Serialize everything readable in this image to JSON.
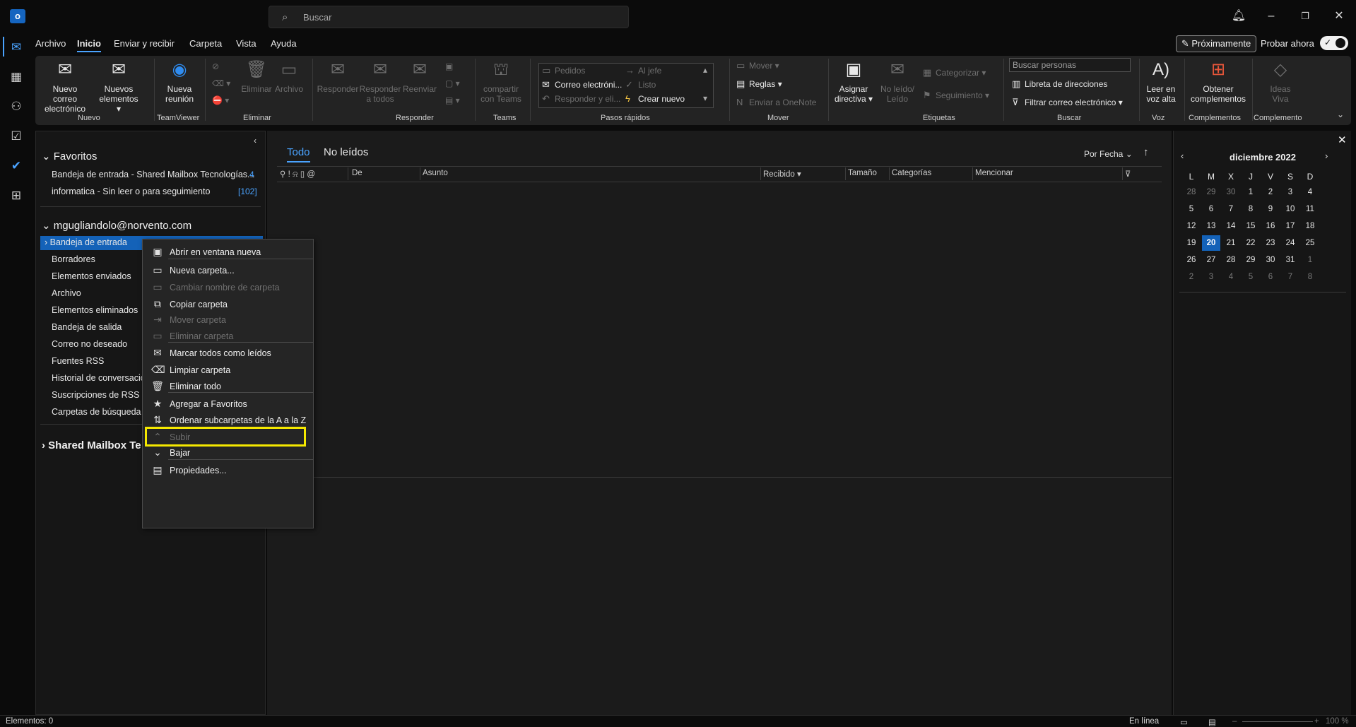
{
  "app": {
    "logo": "o"
  },
  "search": {
    "placeholder": "Buscar"
  },
  "menu": {
    "tabs": [
      "Archivo",
      "Inicio",
      "Enviar y recibir",
      "Carpeta",
      "Vista",
      "Ayuda"
    ],
    "active": "Inicio",
    "proximamente": "Próximamente",
    "probar_ahora": "Probar ahora"
  },
  "ribbon": {
    "nuevo_correo": [
      "Nuevo correo",
      "electrónico"
    ],
    "nuevos_elementos": [
      "Nuevos",
      "elementos"
    ],
    "nueva_reunion": [
      "Nueva",
      "reunión"
    ],
    "eliminar": "Eliminar",
    "archivo": "Archivo",
    "responder": "Responder",
    "responder_todos": [
      "Responder",
      "a todos"
    ],
    "reenviar": "Reenviar",
    "compartir_teams": [
      "compartir",
      "con Teams"
    ],
    "qs_pedidos": "Pedidos",
    "qs_jefe": "Al jefe",
    "qs_correo": "Correo electróni...",
    "qs_listo": "Listo",
    "qs_responder": "Responder y eli...",
    "qs_crear": "Crear nuevo",
    "mover": "Mover",
    "reglas": "Reglas",
    "onenote": "Enviar a OneNote",
    "asignar": [
      "Asignar",
      "directiva"
    ],
    "noleido": [
      "No leído/",
      "Leído"
    ],
    "categorizar": "Categorizar",
    "seguimiento": "Seguimiento",
    "buscar_personas": "Buscar personas",
    "libreta": "Libreta de direcciones",
    "filtrar": "Filtrar correo electrónico",
    "leer_voz": [
      "Leer en",
      "voz alta"
    ],
    "obtener": [
      "Obtener",
      "complementos"
    ],
    "ideas": [
      "Ideas",
      "Viva"
    ],
    "groups": [
      "Nuevo",
      "TeamViewer",
      "Eliminar",
      "Responder",
      "Teams",
      "Pasos rápidos",
      "Mover",
      "Etiquetas",
      "Buscar",
      "Voz",
      "Complementos",
      "Complemento"
    ]
  },
  "folders": {
    "favoritos": "Favoritos",
    "fav_items": [
      {
        "label": "Bandeja de entrada - Shared Mailbox Tecnologías...",
        "count": "4"
      },
      {
        "label": "informatica - Sin leer o para seguimiento",
        "count": "[102]"
      }
    ],
    "account": "mgugliandolo@norvento.com",
    "items": [
      "Bandeja de entrada",
      "Borradores",
      "Elementos enviados",
      "Archivo",
      "Elementos eliminados",
      "Bandeja de salida",
      "Correo no deseado",
      "Fuentes RSS",
      "Historial de conversacion",
      "Suscripciones de RSS",
      "Carpetas de búsqueda"
    ],
    "shared": "Shared Mailbox Te"
  },
  "list": {
    "tab_todo": "Todo",
    "tab_noleidos": "No leídos",
    "sort": "Por Fecha",
    "columns": {
      "de": "De",
      "asunto": "Asunto",
      "recibido": "Recibido",
      "tamano": "Tamaño",
      "categorias": "Categorías",
      "mencionar": "Mencionar"
    }
  },
  "calendar": {
    "month": "diciembre 2022",
    "days": [
      "L",
      "M",
      "X",
      "J",
      "V",
      "S",
      "D"
    ],
    "weeks": [
      [
        "28",
        "29",
        "30",
        "1",
        "2",
        "3",
        "4"
      ],
      [
        "5",
        "6",
        "7",
        "8",
        "9",
        "10",
        "11"
      ],
      [
        "12",
        "13",
        "14",
        "15",
        "16",
        "17",
        "18"
      ],
      [
        "19",
        "20",
        "21",
        "22",
        "23",
        "24",
        "25"
      ],
      [
        "26",
        "27",
        "28",
        "29",
        "30",
        "31",
        "1"
      ],
      [
        "2",
        "3",
        "4",
        "5",
        "6",
        "7",
        "8"
      ]
    ],
    "today": "20"
  },
  "context_menu": [
    {
      "label": "Abrir en ventana nueva",
      "icon": "new-window-icon",
      "enabled": true
    },
    {
      "label": "Nueva carpeta...",
      "icon": "folder-icon",
      "enabled": true
    },
    {
      "label": "Cambiar nombre de carpeta",
      "icon": "rename-icon",
      "enabled": false
    },
    {
      "label": "Copiar carpeta",
      "icon": "copy-icon",
      "enabled": true
    },
    {
      "label": "Mover carpeta",
      "icon": "move-icon",
      "enabled": false
    },
    {
      "label": "Eliminar carpeta",
      "icon": "delete-icon",
      "enabled": false
    },
    {
      "label": "Marcar todos como leídos",
      "icon": "envelope-open-icon",
      "enabled": true
    },
    {
      "label": "Limpiar carpeta",
      "icon": "clean-icon",
      "enabled": true
    },
    {
      "label": "Eliminar todo",
      "icon": "trash-icon",
      "enabled": true
    },
    {
      "label": "Agregar a Favoritos",
      "icon": "star-icon",
      "enabled": true
    },
    {
      "label": "Ordenar subcarpetas de la A a la Z",
      "icon": "sort-az-icon",
      "enabled": true
    },
    {
      "label": "Subir",
      "icon": "chevron-up-icon",
      "enabled": false
    },
    {
      "label": "Bajar",
      "icon": "chevron-down-icon",
      "enabled": true
    },
    {
      "label": "Propiedades...",
      "icon": "properties-icon",
      "enabled": true
    }
  ],
  "status": {
    "elementos": "Elementos: 0",
    "online": "En línea",
    "zoom": "100 %"
  },
  "colors": {
    "accent": "#4aa3ff",
    "selection": "#1462b8",
    "highlight": "#f5e800"
  }
}
